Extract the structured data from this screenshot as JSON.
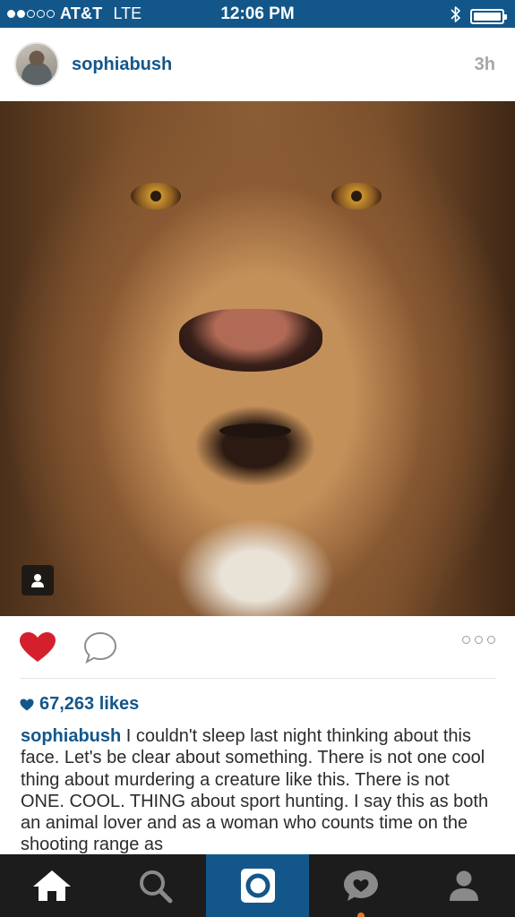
{
  "status_bar": {
    "carrier": "AT&T",
    "network": "LTE",
    "time": "12:06 PM",
    "signal_bars_filled": 2,
    "signal_bars_total": 5,
    "icons": [
      "bluetooth-icon",
      "battery-icon"
    ]
  },
  "post": {
    "username": "sophiabush",
    "time_ago": "3h",
    "photo_description_icon": "user-tag-icon",
    "likes": "67,263 likes",
    "caption_user": "sophiabush",
    "caption_text": " I couldn't sleep last night thinking about this face. Let's be clear about something. There is not one cool thing about murdering a creature like this. There is not ONE. COOL. THING about sport hunting. I say this as both an animal lover and as a woman who counts time on the shooting range as",
    "liked": true
  },
  "actions": {
    "icons": [
      "heart-icon",
      "comment-icon",
      "more-icon"
    ]
  },
  "tab_bar": {
    "tabs": [
      {
        "name": "home",
        "icon": "home-icon",
        "active": false
      },
      {
        "name": "search",
        "icon": "search-icon",
        "active": false
      },
      {
        "name": "camera",
        "icon": "camera-icon",
        "active": true
      },
      {
        "name": "activity",
        "icon": "activity-heart-bubble-icon",
        "active": false,
        "has_notification": true
      },
      {
        "name": "profile",
        "icon": "profile-icon",
        "active": false
      }
    ]
  },
  "colors": {
    "brand_blue": "#13578a",
    "like_red": "#d4202c",
    "tab_bar_bg": "#1c1c1c",
    "notification_orange": "#e8742c"
  }
}
